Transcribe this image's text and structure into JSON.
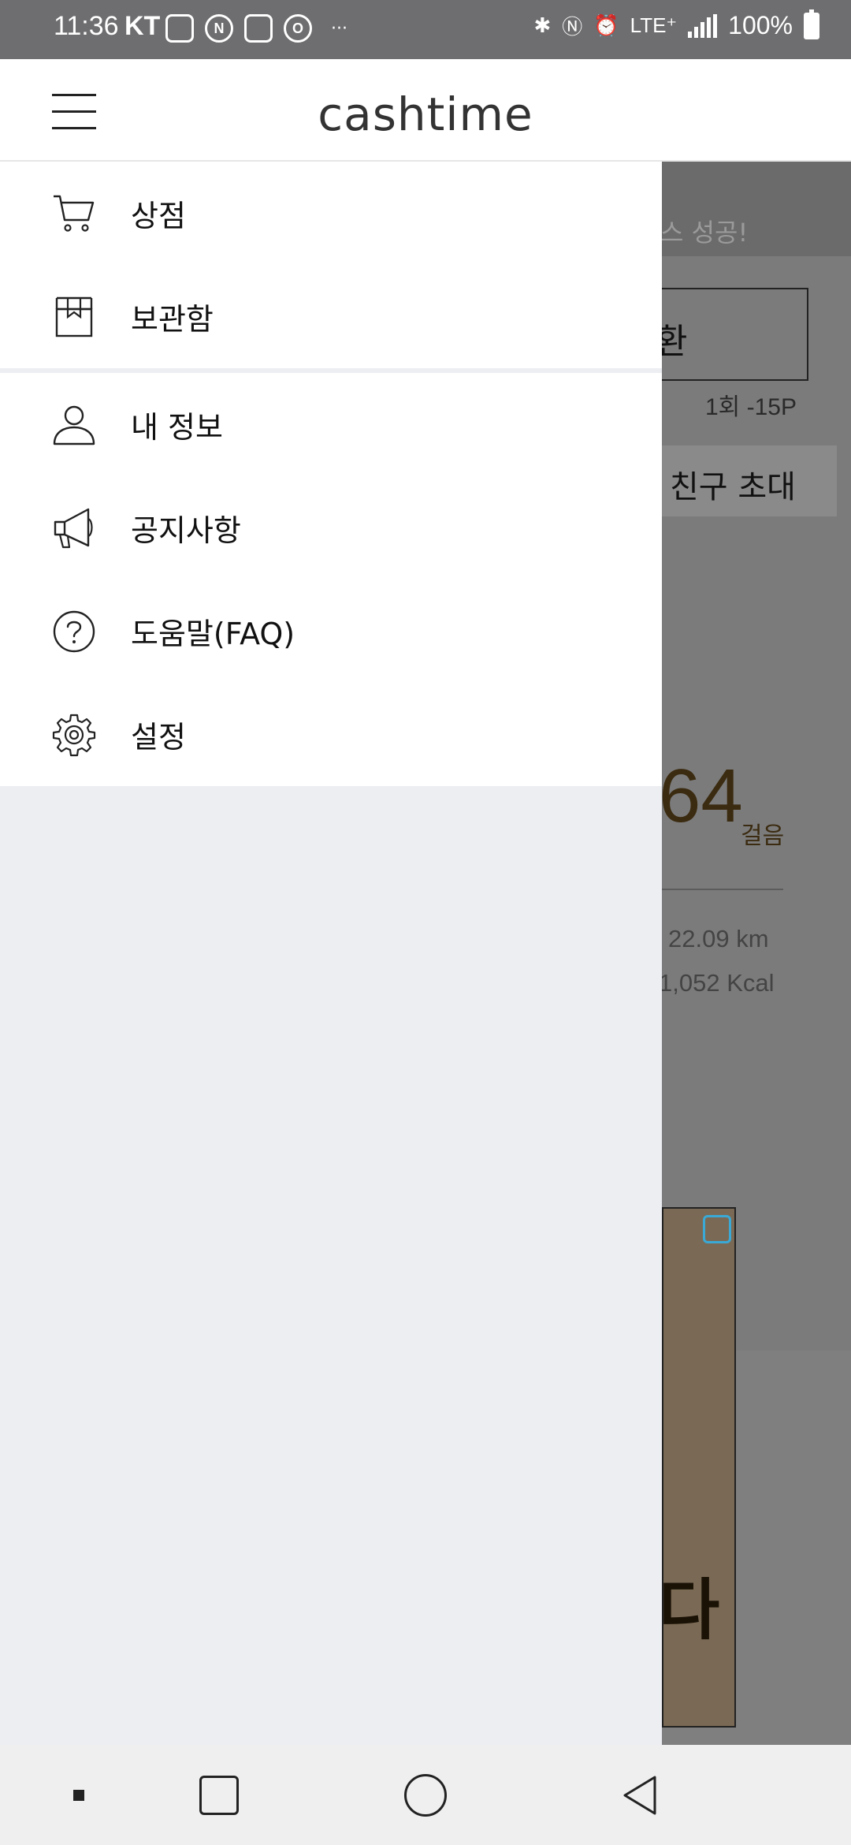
{
  "status_bar": {
    "time": "11:36",
    "carrier": "KT",
    "left_icons": [
      "nfc-sim-icon",
      "naver-icon",
      "app-notify-icon",
      "oh-icon"
    ],
    "dots": "···",
    "network": "LTE⁺",
    "battery": "100%"
  },
  "header": {
    "logo": "cashtime"
  },
  "drawer": {
    "group1": [
      {
        "label": "상점",
        "icon": "cart-icon"
      },
      {
        "label": "보관함",
        "icon": "gift-box-icon"
      }
    ],
    "group2": [
      {
        "label": "내 정보",
        "icon": "person-icon"
      },
      {
        "label": "공지사항",
        "icon": "megaphone-icon"
      },
      {
        "label": "도움말(FAQ)",
        "icon": "help-icon"
      },
      {
        "label": "설정",
        "icon": "gear-icon"
      }
    ]
  },
  "background": {
    "banner_text": "스 성공!",
    "exchange_label": "환",
    "exchange_note": "1회 -15P",
    "invite_label": "친구 초대",
    "steps_value": "64",
    "steps_unit": "걸음",
    "distance": "22.09 km",
    "calories": "1,052 Kcal",
    "ad_text": "다"
  },
  "colors": {
    "scrim": "#7f7f80",
    "drawer_bg": "#eceef2",
    "steps_color": "#3b2b10"
  }
}
